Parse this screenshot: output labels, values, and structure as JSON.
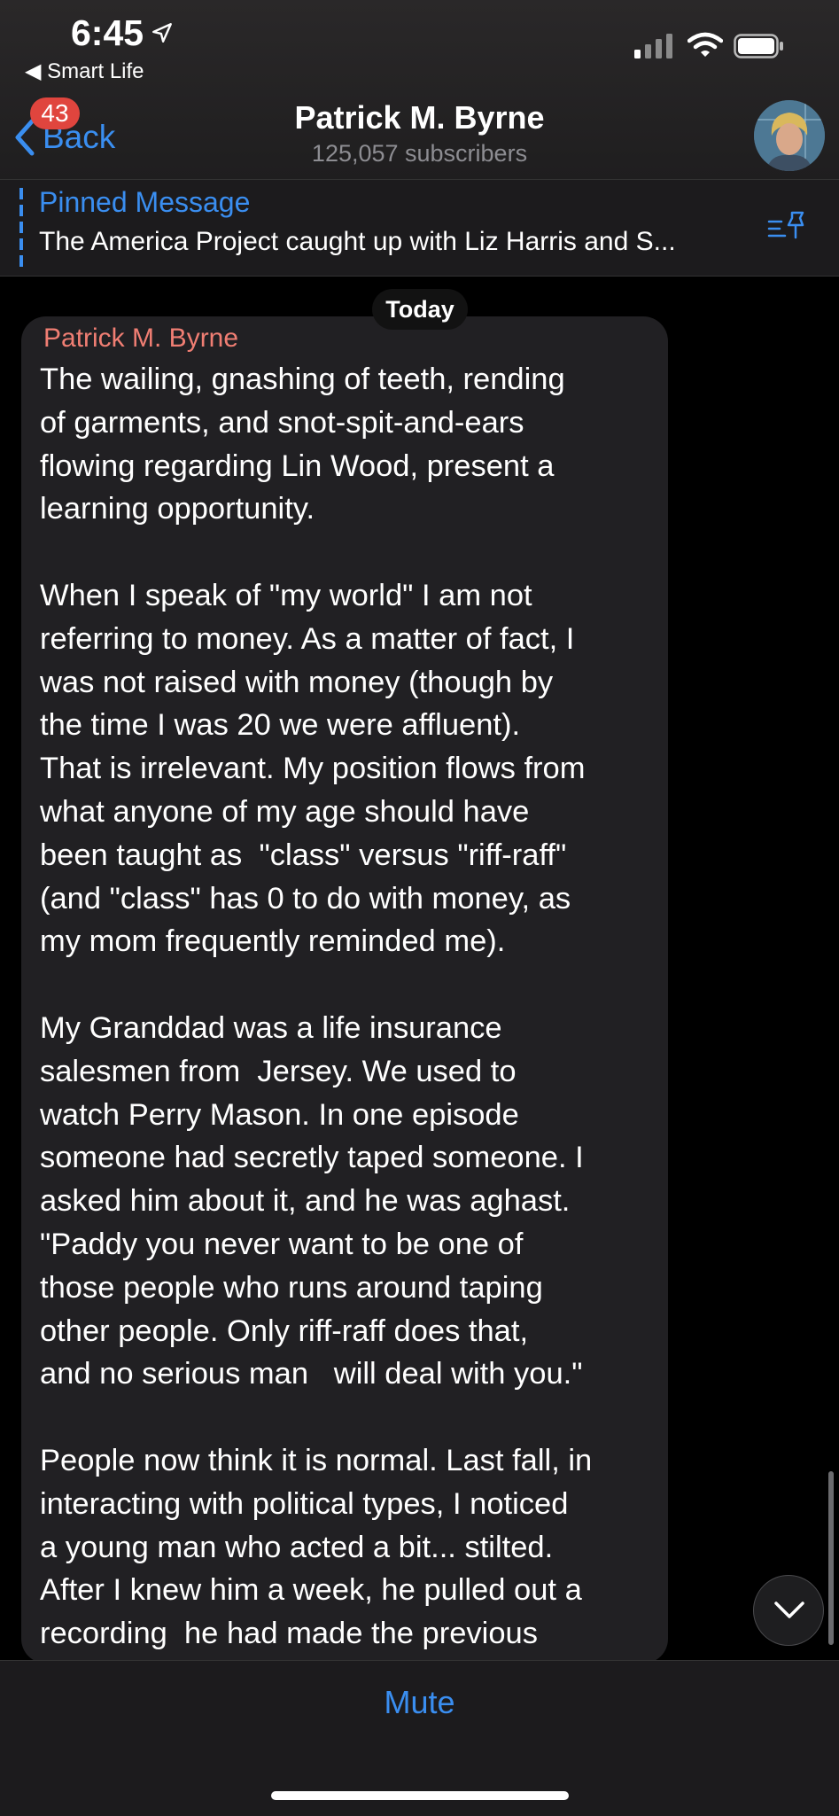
{
  "status_bar": {
    "time": "6:45",
    "back_app": "Smart Life"
  },
  "header": {
    "back_label": "Back",
    "unread_count": "43",
    "title": "Patrick M. Byrne",
    "subtitle": "125,057 subscribers"
  },
  "pinned": {
    "title": "Pinned Message",
    "text": "The America Project caught up with Liz Harris and S..."
  },
  "chat": {
    "date_label": "Today",
    "message": {
      "author": "Patrick M. Byrne",
      "text": "The wailing, gnashing of teeth, rending\nof garments, and snot-spit-and-ears\nflowing regarding Lin Wood, present a\nlearning opportunity.\n\nWhen I speak of \"my world\" I am not\nreferring to money. As a matter of fact, I\nwas not raised with money (though by\nthe time I was 20 we were affluent).\nThat is irrelevant. My position flows from\nwhat anyone of my age should have\nbeen taught as  \"class\" versus \"riff-raff\"\n(and \"class\" has 0 to do with money, as\nmy mom frequently reminded me).\n\nMy Granddad was a life insurance\nsalesmen from  Jersey. We used to\nwatch Perry Mason. In one episode\nsomeone had secretly taped someone. I\nasked him about it, and he was aghast.\n\"Paddy you never want to be one of\nthose people who runs around taping\nother people. Only riff-raff does that,\nand no serious man   will deal with you.\"\n\nPeople now think it is normal. Last fall, in\ninteracting with political types, I noticed\na young man who acted a bit... stilted.\nAfter I knew him a week, he pulled out a\nrecording  he had made the previous"
    }
  },
  "bottom": {
    "mute_label": "Mute"
  },
  "colors": {
    "accent": "#3a8ef0",
    "author": "#f07e73",
    "badge": "#e0453e"
  }
}
